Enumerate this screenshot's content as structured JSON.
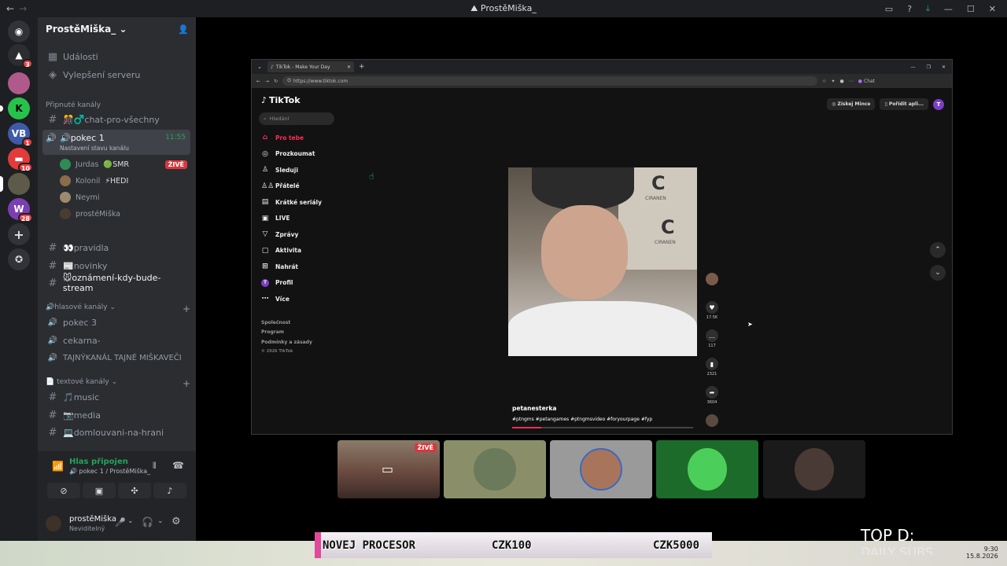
{
  "window": {
    "title": "ProstěMiška_"
  },
  "server": {
    "name": "ProstěMiška_"
  },
  "top_links": [
    {
      "label": "Události",
      "icon": "calendar-icon"
    },
    {
      "label": "Vylepšení serveru",
      "icon": "boost-icon"
    }
  ],
  "pinned_category": "Připnuté kanály",
  "pinned_channels": [
    {
      "label": "🎊♂️chat-pro-všechny"
    },
    {
      "label": "🔊pokec 1",
      "time": "11:55",
      "status": "Nastavení stavu kanálu"
    }
  ],
  "voice_users": [
    {
      "name": "Jurdas",
      "tag": "🟢SMR",
      "live": "ŽIVĚ",
      "color": "#2e8b57"
    },
    {
      "name": "Kolonil",
      "tag": "⚡HEDI",
      "color": "#8b6d4a"
    },
    {
      "name": "Neymi",
      "color": "#9c8a70"
    },
    {
      "name": "prostéMiška",
      "color": "#4a3c30"
    }
  ],
  "other_channels": [
    {
      "label": "👀pravidla"
    },
    {
      "label": "📰novinky"
    },
    {
      "label": "🐭oznámení-kdy-bude-stream",
      "unread": true
    }
  ],
  "voice_category": "🔊hlasové kanály",
  "voice_channels": [
    {
      "label": "pokec 3"
    },
    {
      "label": "cekarna-"
    },
    {
      "label": "TAJNÝKANÁL TAJNÉ MIŠKAVEČI"
    }
  ],
  "text_category": "📄 textové kanály",
  "text_channels": [
    {
      "label": "🎵music"
    },
    {
      "label": "📷media"
    },
    {
      "label": "💻domlouvani-na-hrani"
    }
  ],
  "voice_status": {
    "title": "Hlas připojen",
    "sub": "🔊 pokec 1 / ProstěMiška_"
  },
  "user": {
    "name": "prostěMiška",
    "status": "Neviditelný"
  },
  "server_badges": [
    "3",
    "1",
    "10",
    "28"
  ],
  "browser": {
    "tab_title": "TikTok - Make Your Day",
    "url": "https://www.tiktok.com",
    "chat_label": "Chat"
  },
  "tiktok": {
    "logo": "TikTok",
    "search_placeholder": "Hledání",
    "get_coins": "Získej Mince",
    "get_app": "Pořídit apli...",
    "profile_initial": "T",
    "nav": [
      {
        "label": "Pro tebe",
        "icon": "home-icon",
        "active": true
      },
      {
        "label": "Prozkoumat",
        "icon": "compass-icon"
      },
      {
        "label": "Sleduji",
        "icon": "following-icon"
      },
      {
        "label": "Přátelé",
        "icon": "friends-icon"
      },
      {
        "label": "Krátké seriály",
        "icon": "series-icon"
      },
      {
        "label": "LIVE",
        "icon": "live-icon"
      },
      {
        "label": "Zprávy",
        "icon": "messages-icon"
      },
      {
        "label": "Aktivita",
        "icon": "activity-icon"
      },
      {
        "label": "Nahrát",
        "icon": "upload-icon"
      },
      {
        "label": "Profil",
        "icon": "profile-icon"
      },
      {
        "label": "Více",
        "icon": "more-icon"
      }
    ],
    "footer": [
      "Společnost",
      "Program",
      "Podmínky a zásady",
      "© 2026 TikTok"
    ],
    "video": {
      "author": "petanesterka",
      "hashtags": "#ptngms #petangames #ptngmsvideo #foryourpage #fyp",
      "likes": "17.5K",
      "comments": "117",
      "saves": "2321",
      "shares": "3604",
      "poster_letter": "C",
      "poster_text": "CIRANEN"
    }
  },
  "stream_thumbs": [
    {
      "live": "ŽIVĚ",
      "color": "#6b4a3f"
    },
    {
      "color": "#8a8f6a"
    },
    {
      "color": "#9a9a9a"
    },
    {
      "color": "#1d6b2a"
    },
    {
      "color": "#1a1a1a"
    }
  ],
  "ticker": {
    "left": "NOVEJ PROCESOR",
    "mid": "CZK100",
    "right": "CZK5000"
  },
  "overlay": {
    "top_d": "TOP D:",
    "daily": "DAILY SUBS"
  },
  "clock": {
    "time": "9:30",
    "date": "15.8.2026"
  }
}
